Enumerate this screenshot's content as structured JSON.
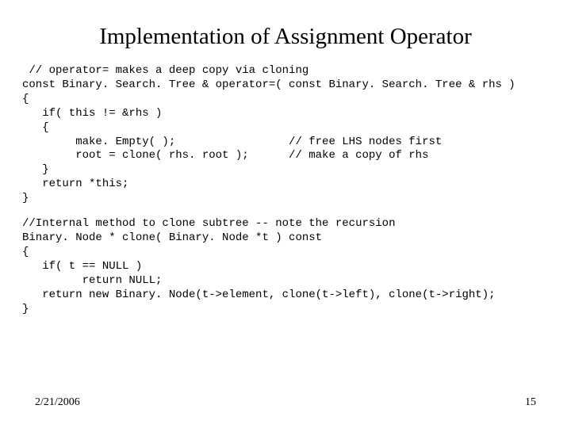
{
  "title": "Implementation of Assignment Operator",
  "code_block_1": " // operator= makes a deep copy via cloning\nconst Binary. Search. Tree & operator=( const Binary. Search. Tree & rhs )\n{\n   if( this != &rhs )\n   {\n        make. Empty( );                 // free LHS nodes first\n        root = clone( rhs. root );      // make a copy of rhs\n   }\n   return *this;\n}",
  "code_block_2": "//Internal method to clone subtree -- note the recursion\nBinary. Node * clone( Binary. Node *t ) const\n{\n   if( t == NULL )\n         return NULL;\n   return new Binary. Node(t->element, clone(t->left), clone(t->right);\n}",
  "footer": {
    "date": "2/21/2006",
    "page": "15"
  }
}
